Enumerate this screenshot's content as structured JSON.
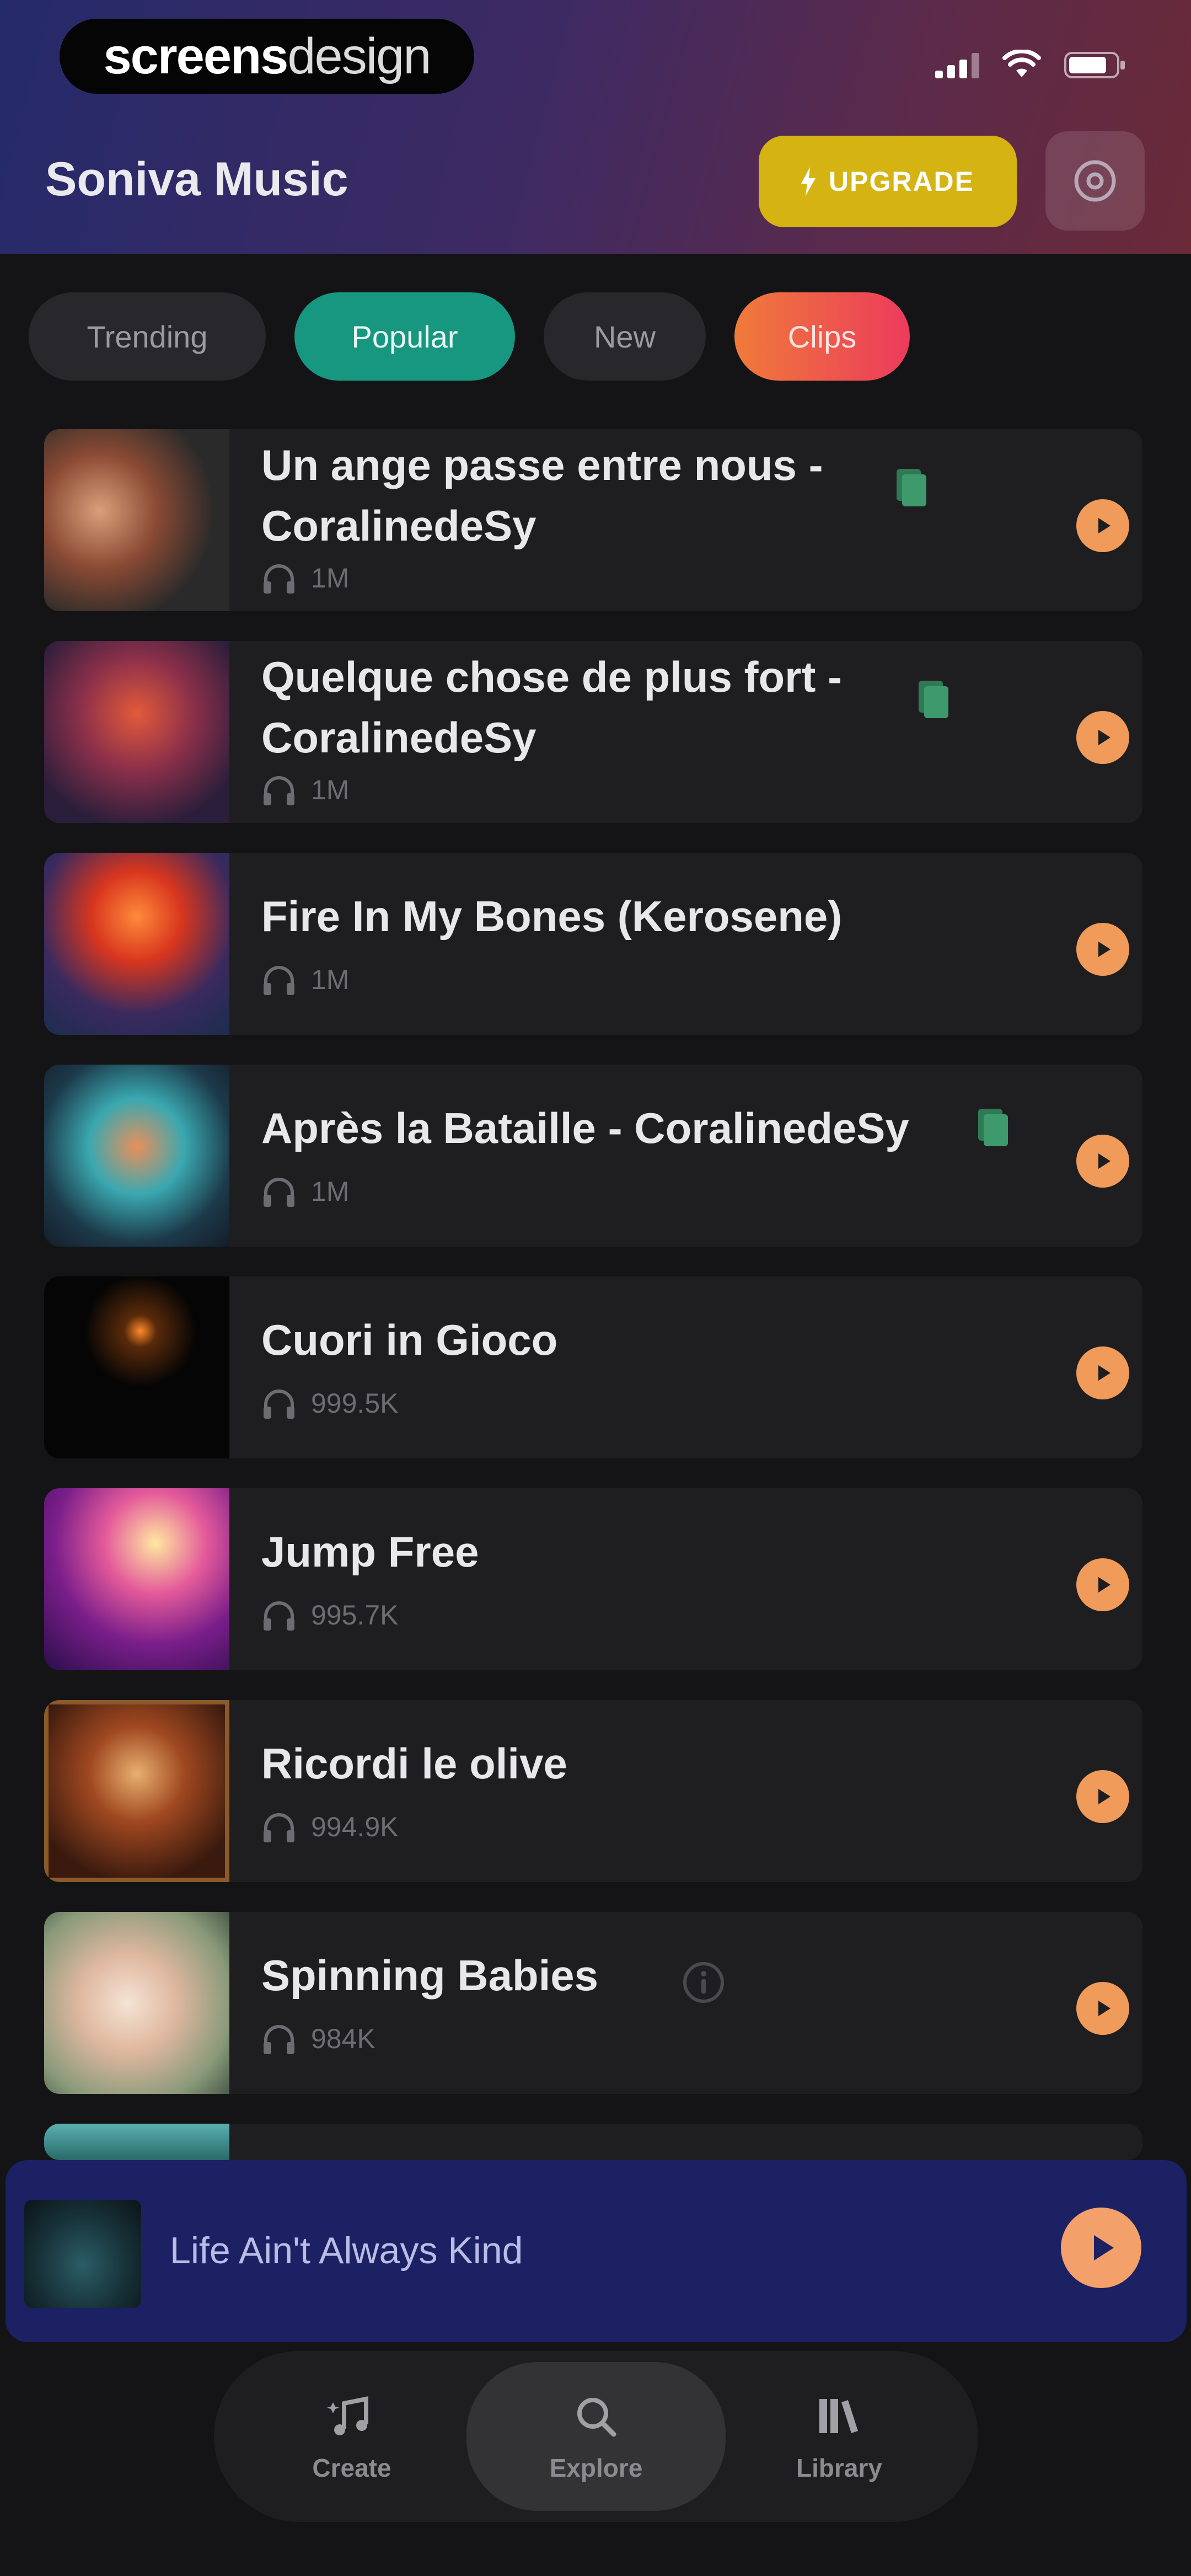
{
  "watermark": {
    "part1": "screens",
    "part2": "design"
  },
  "header": {
    "title": "Soniva Music",
    "upgrade_label": "UPGRADE"
  },
  "filters": [
    {
      "label": "Trending",
      "active": false
    },
    {
      "label": "Popular",
      "active": true
    },
    {
      "label": "New",
      "active": false
    },
    {
      "label": "Clips",
      "active": false
    }
  ],
  "songs": [
    {
      "title_line1": "Un ange passe entre nous -",
      "title_line2": "CoralinedeSy",
      "plays": "1M",
      "badge": true
    },
    {
      "title_line1": "Quelque chose de plus fort -",
      "title_line2": "CoralinedeSy",
      "plays": "1M",
      "badge": true
    },
    {
      "title_line1": "Fire In My Bones (Kerosene)",
      "title_line2": "",
      "plays": "1M",
      "badge": false
    },
    {
      "title_line1": "Après la Bataille - CoralinedeSy",
      "title_line2": "",
      "plays": "1M",
      "badge": true
    },
    {
      "title_line1": "Cuori in Gioco",
      "title_line2": "",
      "plays": "999.5K",
      "badge": false
    },
    {
      "title_line1": "Jump Free",
      "title_line2": "",
      "plays": "995.7K",
      "badge": false
    },
    {
      "title_line1": "Ricordi le olive",
      "title_line2": "",
      "plays": "994.9K",
      "badge": false
    },
    {
      "title_line1": "Spinning Babies",
      "title_line2": "",
      "plays": "984K",
      "badge": false,
      "info": true
    }
  ],
  "player": {
    "title": "Life Ain't Always Kind"
  },
  "nav": [
    {
      "label": "Create",
      "icon": "music-note-icon"
    },
    {
      "label": "Explore",
      "icon": "search-icon"
    },
    {
      "label": "Library",
      "icon": "library-icon"
    }
  ],
  "colors": {
    "accent": "#f09b5a",
    "popular_chip": "#179680",
    "upgrade": "#d4b313",
    "player_bg": "#1b2163"
  }
}
